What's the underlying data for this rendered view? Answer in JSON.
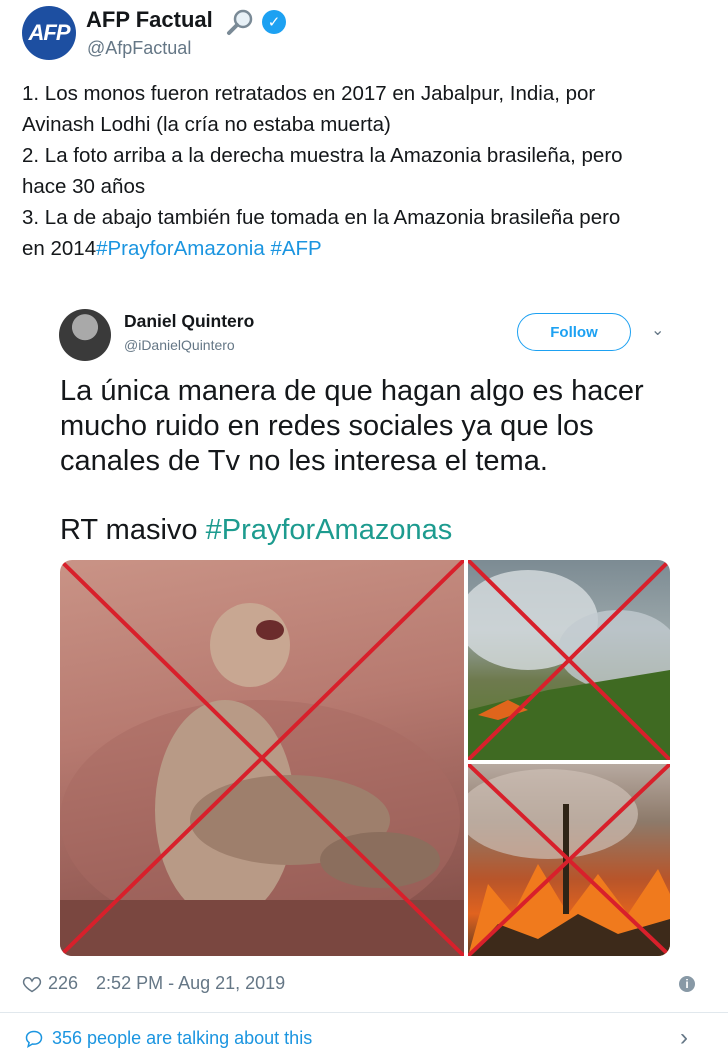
{
  "author": {
    "logo_text": "AFP",
    "name": "AFP Factual",
    "handle": "@AfpFactual"
  },
  "tweet": {
    "lines": [
      "1. Los monos fueron retratados en 2017 en Jabalpur, India, por",
      "Avinash Lodhi (la cría no estaba muerta)",
      "2. La foto arriba a la derecha muestra la Amazonia brasileña, pero",
      "hace 30 años",
      "3. La de abajo también fue tomada en la Amazonia brasileña pero"
    ],
    "last_line_prefix": "en 2014",
    "hashtag1": "#PrayforAmazonia",
    "hashtag2": "#AFP"
  },
  "embedded": {
    "name": "Daniel Quintero",
    "handle": "@iDanielQuintero",
    "follow_label": "Follow",
    "text_lines": [
      "La única manera de que hagan algo es hacer",
      "mucho ruido en redes sociales ya que los",
      "canales de Tv no les interesa el tema."
    ],
    "rt_prefix": "RT masivo ",
    "rt_hashtag": "#PrayforAmazonas"
  },
  "footer": {
    "likes": "226",
    "timestamp": "2:52 PM - Aug 21, 2019",
    "talking": "356 people are talking about this"
  },
  "colors": {
    "link": "#1b95e0",
    "cross": "#d8202b",
    "afp_blue": "#1d4fa1"
  }
}
